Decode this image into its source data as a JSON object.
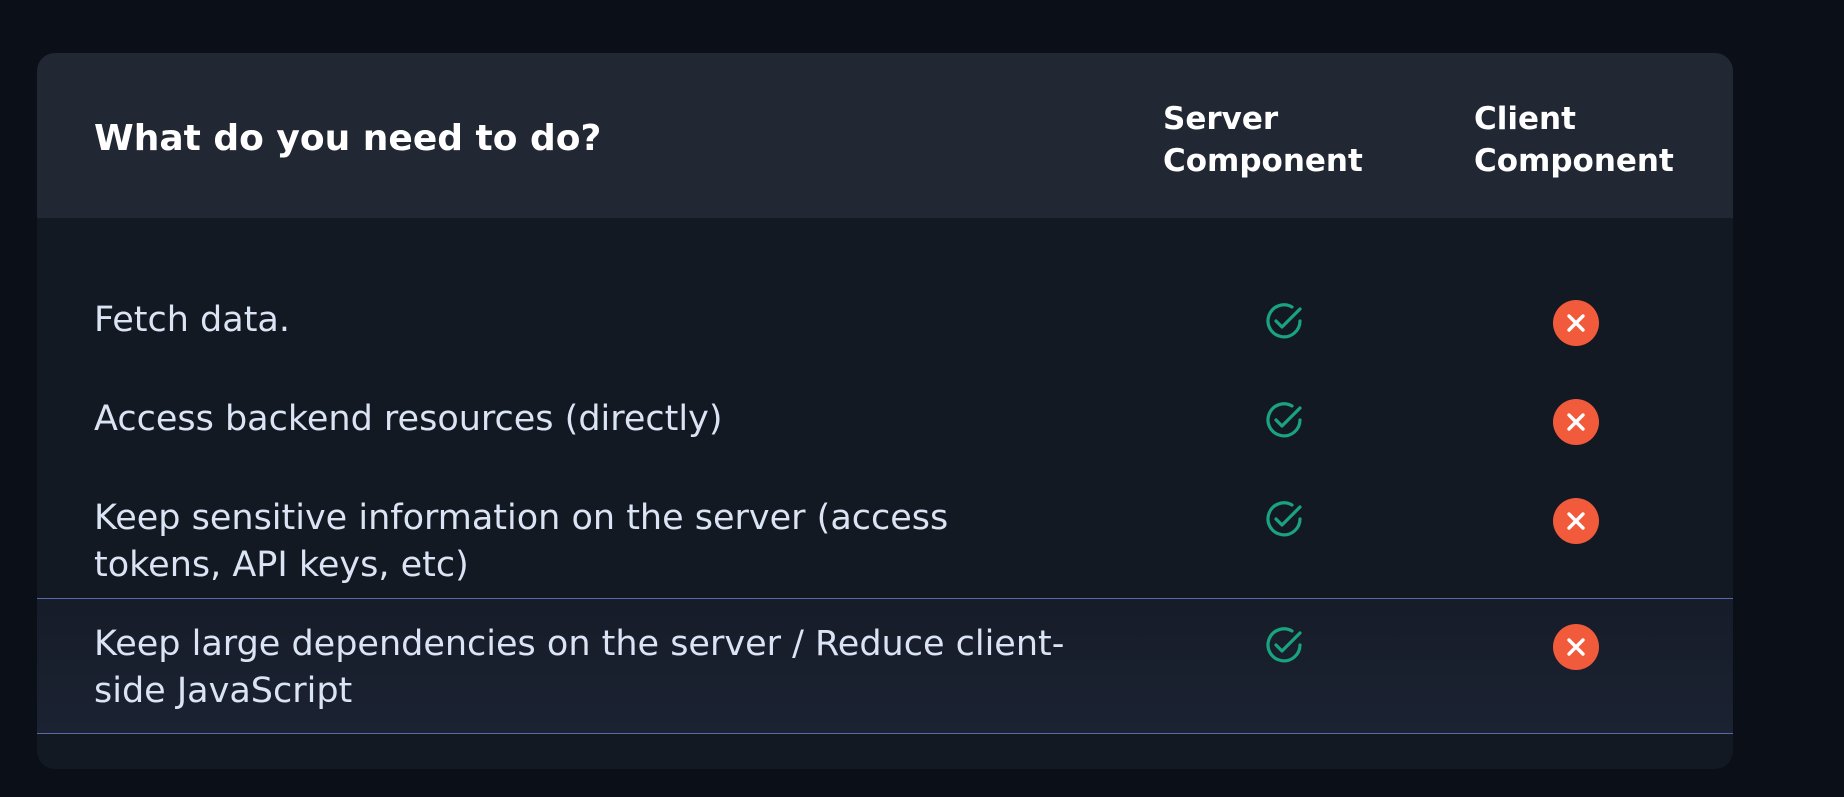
{
  "table": {
    "question": "What do you need to do?",
    "columns": [
      {
        "label": "Server\nComponent"
      },
      {
        "label": "Client\nComponent"
      }
    ],
    "rows": [
      {
        "label": "Fetch data.",
        "server": "check",
        "client": "cross"
      },
      {
        "label": "Access backend resources (directly)",
        "server": "check",
        "client": "cross"
      },
      {
        "label": "Keep sensitive information on the server (access tokens, API keys, etc)",
        "server": "check",
        "client": "cross"
      },
      {
        "label": "Keep large dependencies on the server / Reduce client-side JavaScript",
        "server": "check",
        "client": "cross"
      }
    ]
  },
  "colors": {
    "background": "#0b0f17",
    "card": "#131922",
    "header": "#212733",
    "check": "#1aa37f",
    "cross": "#f25a3c",
    "highlight_border": "#5a6aa8"
  },
  "icons": {
    "check": "check-circle-icon",
    "cross": "x-circle-icon"
  }
}
